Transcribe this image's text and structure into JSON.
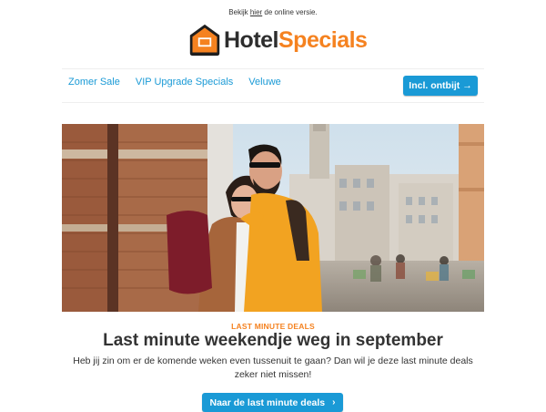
{
  "preheader": {
    "before": "Bekijk ",
    "link": "hier",
    "after": " de online versie."
  },
  "logo": {
    "part1": "Hotel",
    "part2": "Specials",
    "icon": "house-icon",
    "brand_orange": "#f58220",
    "brand_dark": "#2d2d2d"
  },
  "nav": {
    "items": [
      "Zomer Sale",
      "VIP Upgrade Specials",
      "Veluwe"
    ],
    "cta_label": "Incl. ontbijt →"
  },
  "hero": {
    "image": "photo-couple-city-square"
  },
  "article": {
    "eyebrow": "LAST MINUTE DEALS",
    "title": "Last minute weekendje weg in september",
    "body": "Heb jij zin om er de komende weken even tussenuit te gaan? Dan wil je deze last minute deals zeker niet missen!",
    "cta_label": "Naar de last minute deals",
    "cta_icon": "chevron-right-icon"
  },
  "colors": {
    "accent": "#1a9ad6",
    "orange": "#f58220"
  }
}
